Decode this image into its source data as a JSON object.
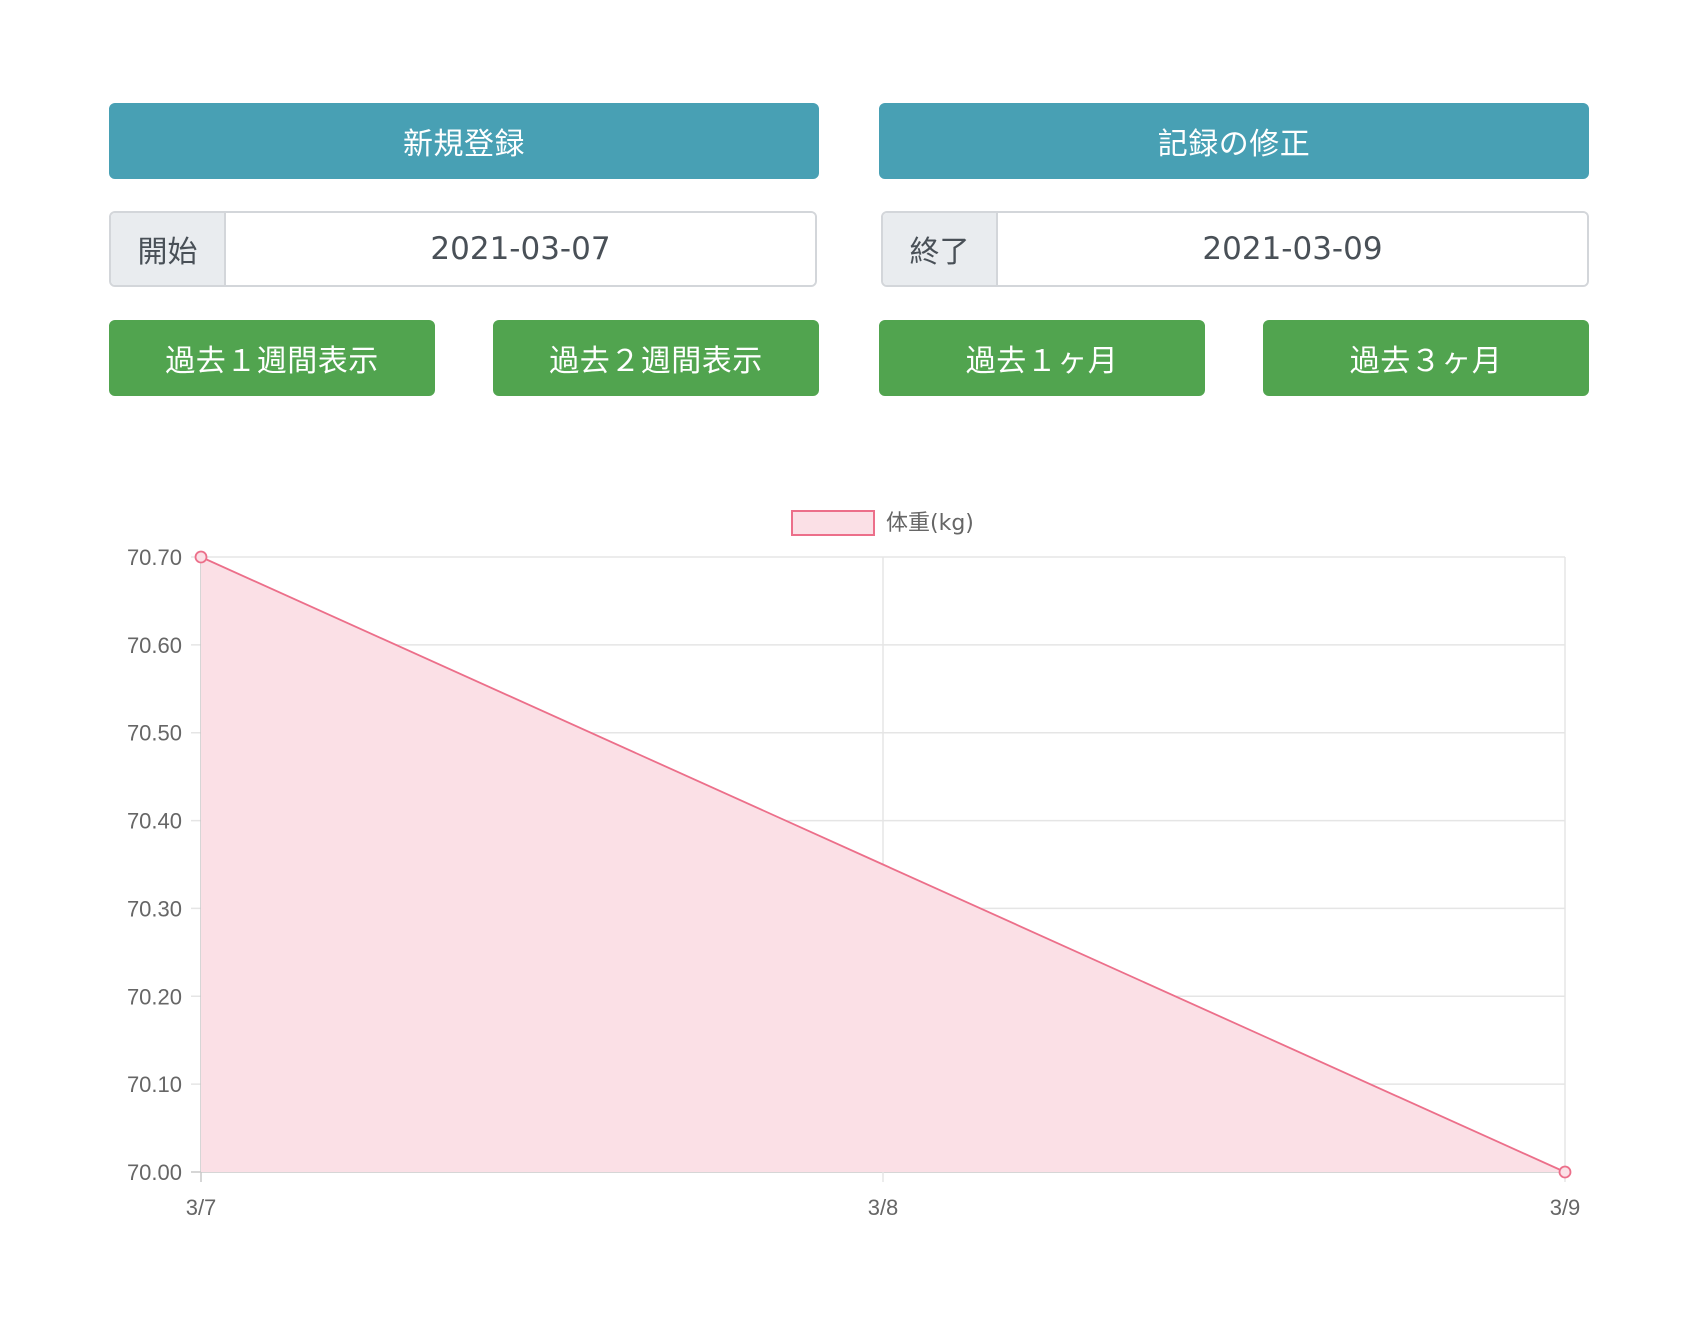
{
  "header": {
    "register_label": "新規登録",
    "edit_label": "記録の修正"
  },
  "dates": {
    "start_label": "開始",
    "start_value": "2021-03-07",
    "end_label": "終了",
    "end_value": "2021-03-09"
  },
  "range_buttons": {
    "week1": "過去１週間表示",
    "week2": "過去２週間表示",
    "month1": "過去１ヶ月",
    "month3": "過去３ヶ月"
  },
  "colors": {
    "info": "#48a0b4",
    "success": "#51a44f",
    "line": "#ec6f8a",
    "fill": "#fbe0e6",
    "grid": "#e5e5e5"
  },
  "chart_data": {
    "type": "area",
    "categories": [
      "3/7",
      "3/8",
      "3/9"
    ],
    "series": [
      {
        "name": "体重(kg)",
        "values": [
          70.7,
          70.35,
          70.0
        ]
      }
    ],
    "point_markers_on": [
      "3/7",
      "3/9"
    ],
    "ylim": [
      70.0,
      70.7
    ],
    "yticks": [
      "70.70",
      "70.60",
      "70.50",
      "70.40",
      "70.30",
      "70.20",
      "70.10",
      "70.00"
    ],
    "grid": true,
    "legend": "top-center"
  }
}
